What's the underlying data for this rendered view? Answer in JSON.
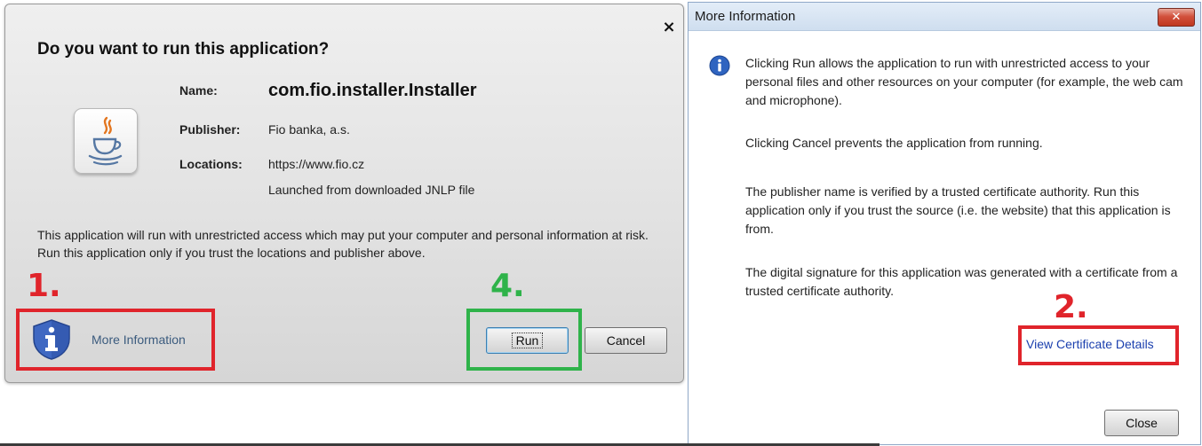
{
  "run_dialog": {
    "title": "Do you want to run this application?",
    "close_glyph": "×",
    "name_label": "Name:",
    "name_value": "com.fio.installer.Installer",
    "publisher_label": "Publisher:",
    "publisher_value": "Fio banka, a.s.",
    "locations_label": "Locations:",
    "locations_value": "https://www.fio.cz",
    "launched_text": "Launched from downloaded JNLP file",
    "warning_text": "This application will run with unrestricted access which may put your computer and personal information at risk. Run this application only if you trust the locations and publisher above.",
    "more_info_label": "More Information",
    "run_label": "Run",
    "cancel_label": "Cancel"
  },
  "annotations": {
    "step1": "1.",
    "step2": "2.",
    "step4": "4.",
    "step1_color": "#e0242b",
    "step2_color": "#e0242b",
    "step4_color": "#2fb34a"
  },
  "info_window": {
    "title": "More Information",
    "close_glyph": "✕",
    "paragraphs": [
      "Clicking Run allows the application to run with unrestricted access to your personal files and other resources on your computer (for example, the web cam and microphone).",
      "Clicking Cancel prevents the application from running.",
      "The publisher name is verified by a trusted certificate authority. Run this application only if you trust the source (i.e. the website) that this application is from.",
      "The digital signature for this application was generated with a certificate from a trusted certificate authority."
    ],
    "cert_link": "View Certificate Details",
    "close_label": "Close"
  },
  "icons": {
    "java": "java-cup-icon",
    "shield": "shield-info-icon",
    "info": "info-icon"
  }
}
